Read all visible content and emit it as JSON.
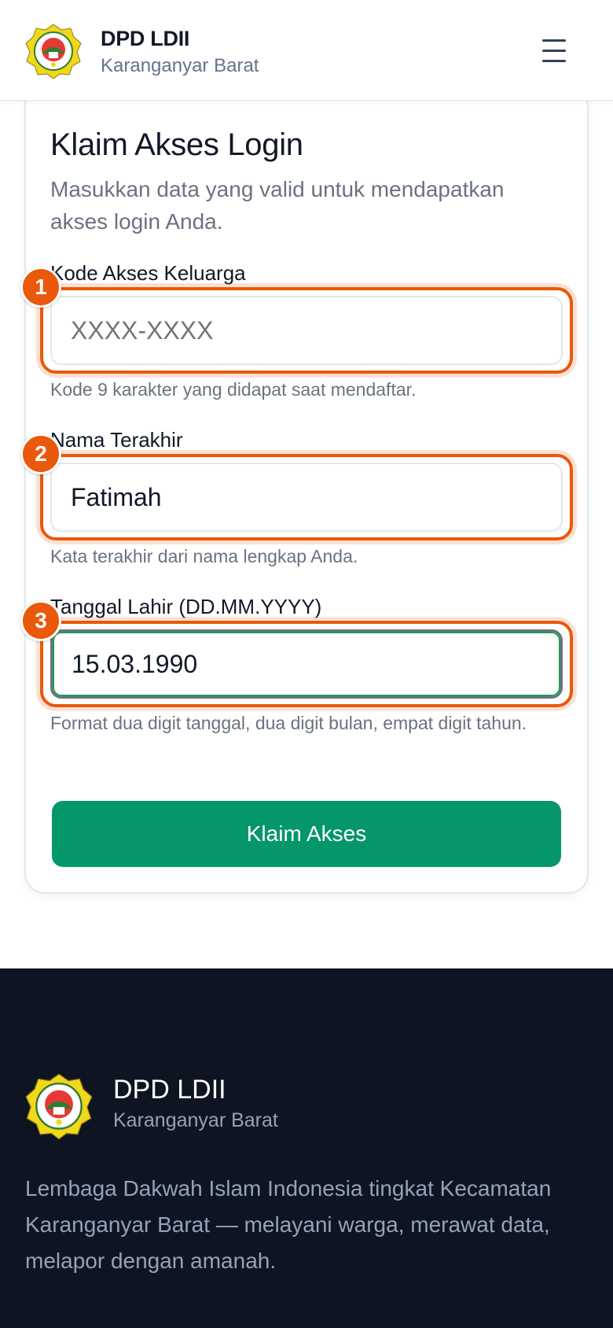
{
  "header": {
    "title": "DPD LDII",
    "subtitle": "Karanganyar Barat",
    "menu_icon": "hamburger-menu-icon"
  },
  "form": {
    "title": "Klaim Akses Login",
    "description": "Masukkan data yang valid untuk mendapatkan akses login Anda.",
    "fields": [
      {
        "badge": "1",
        "label": "Kode Akses Keluarga",
        "placeholder": "XXXX-XXXX",
        "value": "",
        "hint": "Kode 9 karakter yang didapat saat mendaftar."
      },
      {
        "badge": "2",
        "label": "Nama Terakhir",
        "placeholder": "",
        "value": "Fatimah",
        "hint": "Kata terakhir dari nama lengkap Anda."
      },
      {
        "badge": "3",
        "label": "Tanggal Lahir (DD.MM.YYYY)",
        "placeholder": "",
        "value": "15.03.1990",
        "hint": "Format dua digit tanggal, dua digit bulan, empat digit tahun."
      }
    ],
    "submit_label": "Klaim Akses"
  },
  "footer": {
    "title": "DPD LDII",
    "subtitle": "Karanganyar Barat",
    "description": "Lembaga Dakwah Islam Indonesia tingkat Kecamatan Karanganyar Barat — melayani warga, merawat data, melapor dengan amanah."
  },
  "colors": {
    "accent": "#059669",
    "highlight": "#ea580c",
    "footer_bg": "#0f1422"
  }
}
